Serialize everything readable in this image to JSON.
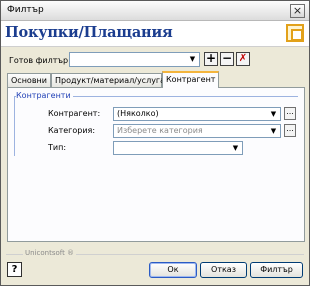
{
  "window": {
    "title": "Филтър",
    "close_glyph": "×"
  },
  "header": {
    "title": "Покупки/Плащания",
    "logo_icon": "orange-square-icon"
  },
  "filter_row": {
    "label": "Готов филтър:",
    "value": "",
    "add_glyph": "+",
    "remove_glyph": "−",
    "clear_glyph": "✗"
  },
  "tabs": [
    {
      "label": "Основни",
      "active": false
    },
    {
      "label": "Продукт/материал/услуга",
      "active": false
    },
    {
      "label": "Контрагент",
      "active": true
    }
  ],
  "group": {
    "title": "Контрагенти",
    "fields": [
      {
        "label": "Контрагент:",
        "value": "(Няколко)",
        "placeholder": ""
      },
      {
        "label": "Категория:",
        "value": "",
        "placeholder": "Изберете категория"
      },
      {
        "label": "Тип:",
        "value": "",
        "placeholder": ""
      }
    ],
    "ellipsis": "..."
  },
  "footer": {
    "brand": "Unicontsoft ®",
    "help_glyph": "?",
    "ok_label": "Ок",
    "cancel_label": "Отказ",
    "filter_label": "Филтър"
  },
  "colors": {
    "accent_title": "#1b3d8f",
    "group_title": "#1f3fb6",
    "active_tab_border": "#f4b53d",
    "logo": "#e2a11a"
  }
}
